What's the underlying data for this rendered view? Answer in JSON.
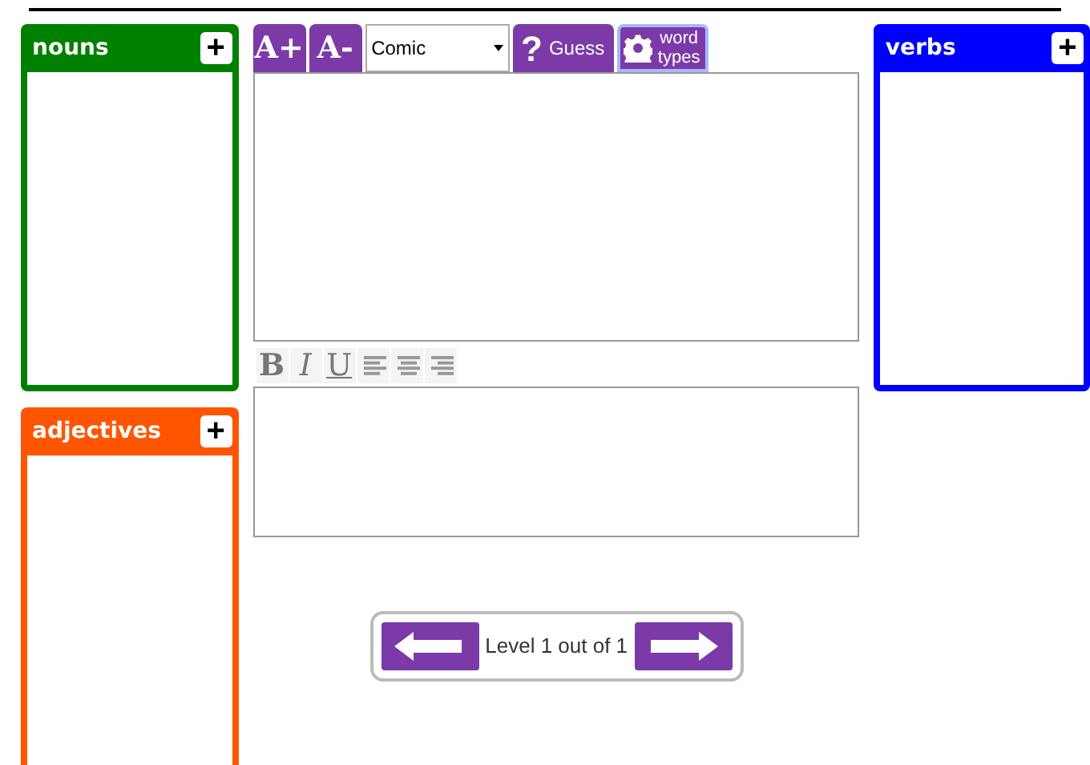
{
  "left_panels": [
    {
      "title": "nouns",
      "color": "#008000",
      "add": "+"
    },
    {
      "title": "adjectives",
      "color": "#ff5500",
      "add": "+"
    }
  ],
  "right_panels": [
    {
      "title": "verbs",
      "color": "#0000ff",
      "add": "+"
    }
  ],
  "toolbar": {
    "bigger": "A+",
    "smaller": "A-",
    "font": "Comic",
    "guess_mark": "?",
    "guess": "Guess",
    "word_types": "word types",
    "word_types_selected": true
  },
  "format_buttons": [
    {
      "label": "B",
      "kind": "bold"
    },
    {
      "label": "I",
      "kind": "italic"
    },
    {
      "label": "U",
      "kind": "underline"
    },
    {
      "kind": "align-left"
    },
    {
      "kind": "align-center"
    },
    {
      "kind": "align-right"
    }
  ],
  "level_text": "Level 1 out of 1"
}
